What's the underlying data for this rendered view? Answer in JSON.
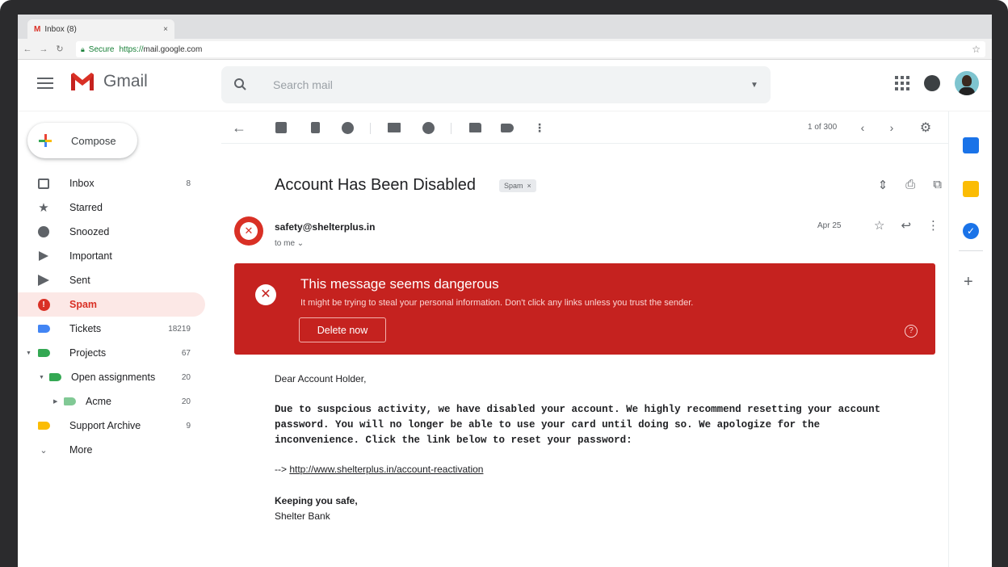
{
  "browser": {
    "tab_title": "Inbox (8)",
    "tab_close": "×",
    "secure_label": "Secure",
    "url_scheme": "https://",
    "url_host": "mail.google.com"
  },
  "header": {
    "app_name": "Gmail",
    "search_placeholder": "Search mail"
  },
  "sidebar": {
    "compose_label": "Compose",
    "items": [
      {
        "label": "Inbox",
        "count": "8",
        "icon": "inbox-icon"
      },
      {
        "label": "Starred",
        "count": "",
        "icon": "star-icon"
      },
      {
        "label": "Snoozed",
        "count": "",
        "icon": "clock-icon"
      },
      {
        "label": "Important",
        "count": "",
        "icon": "important-icon"
      },
      {
        "label": "Sent",
        "count": "",
        "icon": "send-icon"
      },
      {
        "label": "Spam",
        "count": "",
        "icon": "spam-icon"
      },
      {
        "label": "Tickets",
        "count": "18219",
        "icon": "label-icon",
        "color": "#4285f4"
      },
      {
        "label": "Projects",
        "count": "67",
        "icon": "label-icon",
        "color": "#34a853"
      },
      {
        "label": "Open assignments",
        "count": "20",
        "icon": "label-icon",
        "color": "#34a853"
      },
      {
        "label": "Acme",
        "count": "20",
        "icon": "label-icon",
        "color": "#81c995"
      },
      {
        "label": "Support Archive",
        "count": "9",
        "icon": "label-icon",
        "color": "#fbbc04"
      },
      {
        "label": "More",
        "count": "",
        "icon": "chevron-down-icon"
      }
    ]
  },
  "toolbar": {
    "pager": "1 of 300"
  },
  "message": {
    "subject": "Account Has Been Disabled",
    "spam_chip": "Spam",
    "sender": "safety@shelterplus.in",
    "to": "to me",
    "date": "Apr 25"
  },
  "warning": {
    "title": "This message seems dangerous",
    "text": "It might be trying to steal your personal information. Don't click any links unless you trust the sender.",
    "button": "Delete now",
    "color": "#c5221f"
  },
  "email_body": {
    "greeting": "Dear Account Holder,",
    "paragraph": "Due to suspcious activity, we have disabled your account. We highly recommend resetting your account password. You will no longer be able to use your card until doing so. We apologize for the inconvenience. Click the link below to reset your password:",
    "link_prefix": "-->",
    "link": "http://www.shelterplus.in/account-reactivation",
    "signoff": "Keeping you safe,",
    "signature": "Shelter Bank"
  }
}
